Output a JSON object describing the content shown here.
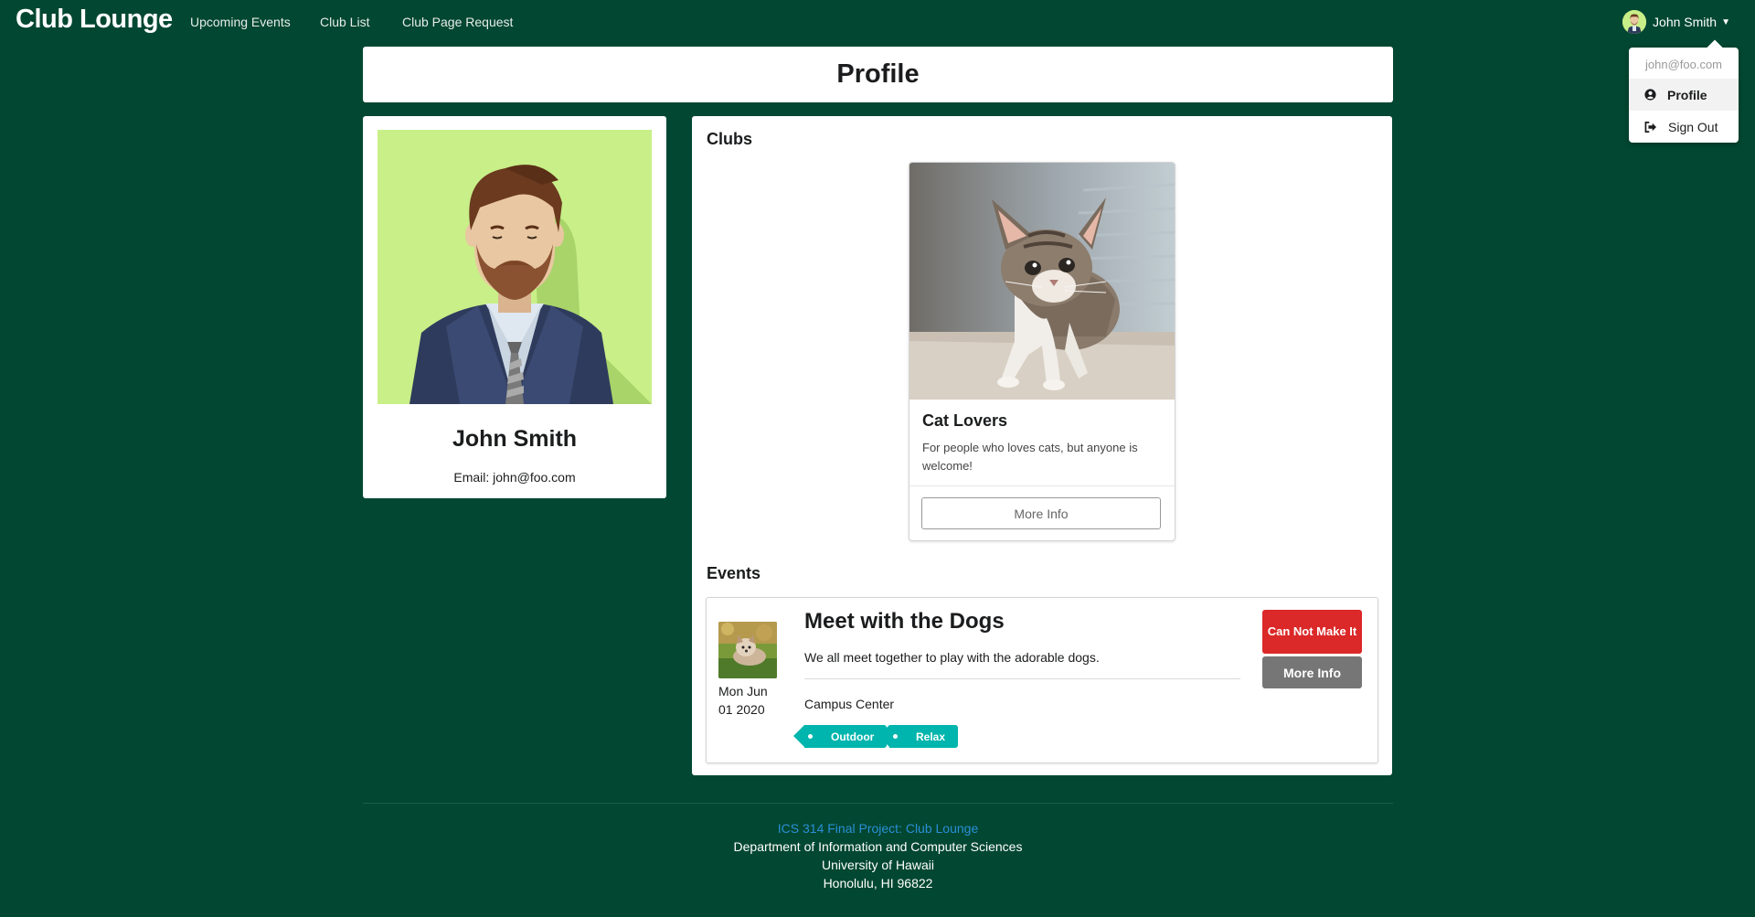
{
  "navbar": {
    "brand": "Club Lounge",
    "links": [
      "Upcoming Events",
      "Club List",
      "Club Page Request"
    ],
    "user_name": "John Smith"
  },
  "dropdown": {
    "email": "john@foo.com",
    "items": [
      {
        "label": "Profile",
        "icon": "user-circle-icon",
        "active": true
      },
      {
        "label": "Sign Out",
        "icon": "sign-out-icon",
        "active": false
      }
    ]
  },
  "page": {
    "title": "Profile"
  },
  "profile": {
    "name": "John Smith",
    "email_label": "Email: john@foo.com"
  },
  "clubs_section": {
    "heading": "Clubs",
    "clubs": [
      {
        "name": "Cat Lovers",
        "description": "For people who loves cats, but anyone is welcome!",
        "button": "More Info"
      }
    ]
  },
  "events_section": {
    "heading": "Events",
    "events": [
      {
        "date_line1": "Mon Jun",
        "date_line2": "01 2020",
        "title": "Meet with the Dogs",
        "description": "We all meet together to play with the adorable dogs.",
        "location": "Campus Center",
        "tags": [
          "Outdoor",
          "Relax"
        ],
        "cannot_button": "Can Not Make It",
        "more_button": "More Info"
      }
    ]
  },
  "footer": {
    "link": "ICS 314 Final Project: Club Lounge",
    "lines": [
      "Department of Information and Computer Sciences",
      "University of Hawaii",
      "Honolulu, HI 96822"
    ]
  },
  "colors": {
    "background": "#024731",
    "danger": "#db2828",
    "tag": "#00b5ad",
    "grey_button": "#767676"
  }
}
